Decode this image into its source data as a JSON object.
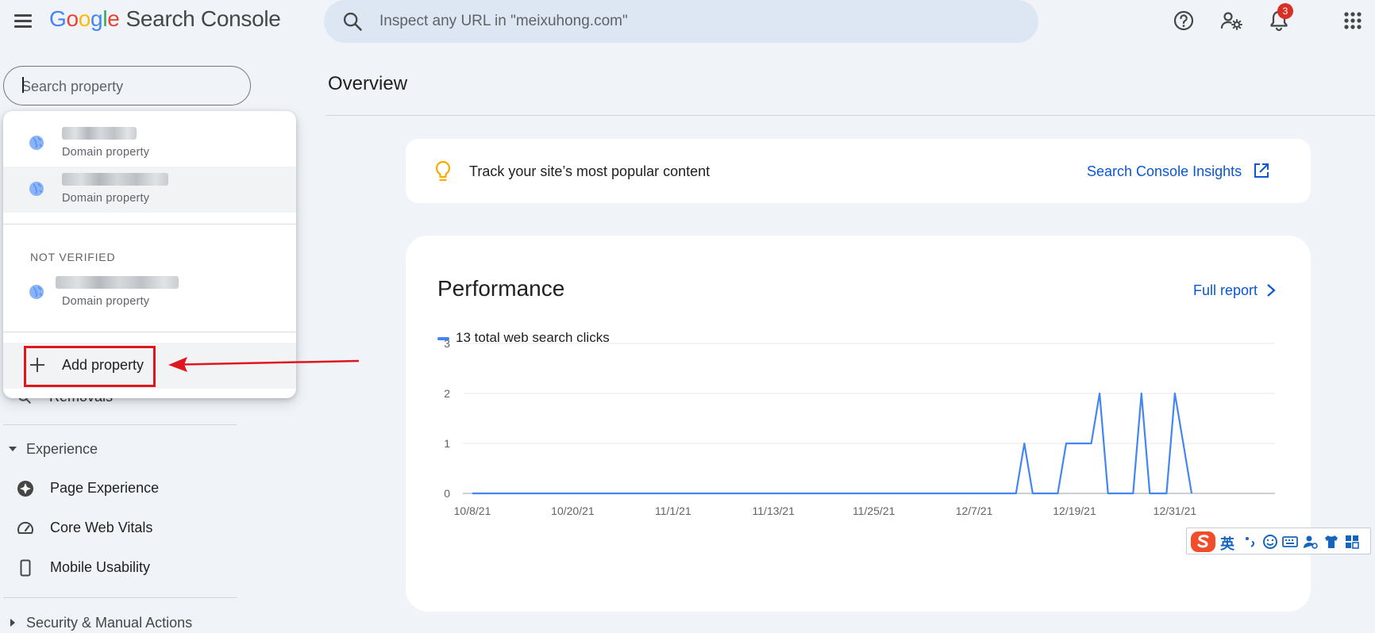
{
  "app": {
    "logo_letters": [
      {
        "ch": "G",
        "color": "#4285f4"
      },
      {
        "ch": "o",
        "color": "#ea4335"
      },
      {
        "ch": "o",
        "color": "#fbbc05"
      },
      {
        "ch": "g",
        "color": "#4285f4"
      },
      {
        "ch": "l",
        "color": "#34a853"
      },
      {
        "ch": "e",
        "color": "#ea4335"
      }
    ],
    "product_name": "Search Console",
    "url_inspect_placeholder": "Inspect any URL in \"meixuhong.com\"",
    "notification_count": "3",
    "icons": [
      "menu-icon",
      "search-icon",
      "help-icon",
      "manage-users-icon",
      "bell-icon",
      "apps-grid-icon"
    ]
  },
  "sidebar": {
    "property_search_placeholder": "Search property",
    "partial_item": "Removals",
    "sections": [
      {
        "label": "Experience",
        "items": [
          {
            "label": "Page Experience",
            "icon": "page-experience-icon"
          },
          {
            "label": "Core Web Vitals",
            "icon": "speedometer-icon"
          },
          {
            "label": "Mobile Usability",
            "icon": "phone-icon"
          }
        ]
      },
      {
        "label": "Security & Manual Actions",
        "items": []
      }
    ]
  },
  "property_dropdown": {
    "verified": [
      {
        "type": "Domain property"
      },
      {
        "type": "Domain property"
      }
    ],
    "not_verified_heading": "NOT VERIFIED",
    "not_verified": [
      {
        "type": "Domain property"
      }
    ],
    "add_property_label": "Add property"
  },
  "main": {
    "page_title": "Overview",
    "insights": {
      "text": "Track your site’s most popular content",
      "link_label": "Search Console Insights"
    },
    "performance": {
      "title": "Performance",
      "full_report_label": "Full report",
      "legend_label": "13 total web search clicks",
      "series_color": "#4285f4"
    }
  },
  "ime": {
    "lang_char": "英"
  },
  "chart_data": {
    "type": "line",
    "title": "",
    "xlabel": "",
    "ylabel": "",
    "ylim": [
      0,
      3
    ],
    "yticks": [
      "0",
      "1",
      "2",
      "3"
    ],
    "x_tick_labels": [
      "10/8/21",
      "10/20/21",
      "11/1/21",
      "11/13/21",
      "11/25/21",
      "12/7/21",
      "12/19/21",
      "12/31/21"
    ],
    "grid": true,
    "series": [
      {
        "values": [
          0,
          0,
          0,
          0,
          0,
          0,
          0,
          0,
          0,
          0,
          0,
          0,
          0,
          0,
          0,
          0,
          0,
          0,
          0,
          0,
          0,
          0,
          0,
          0,
          0,
          0,
          0,
          0,
          0,
          0,
          0,
          0,
          0,
          0,
          0,
          0,
          0,
          0,
          0,
          0,
          0,
          0,
          0,
          0,
          0,
          0,
          0,
          0,
          0,
          0,
          0,
          0,
          0,
          0,
          0,
          0,
          0,
          0,
          0,
          0,
          0,
          0,
          0,
          0,
          0,
          0,
          1,
          0,
          0,
          0,
          0,
          1,
          1,
          1,
          1,
          2,
          0,
          0,
          0,
          0,
          2,
          0,
          0,
          0,
          2,
          1,
          0
        ]
      }
    ]
  }
}
